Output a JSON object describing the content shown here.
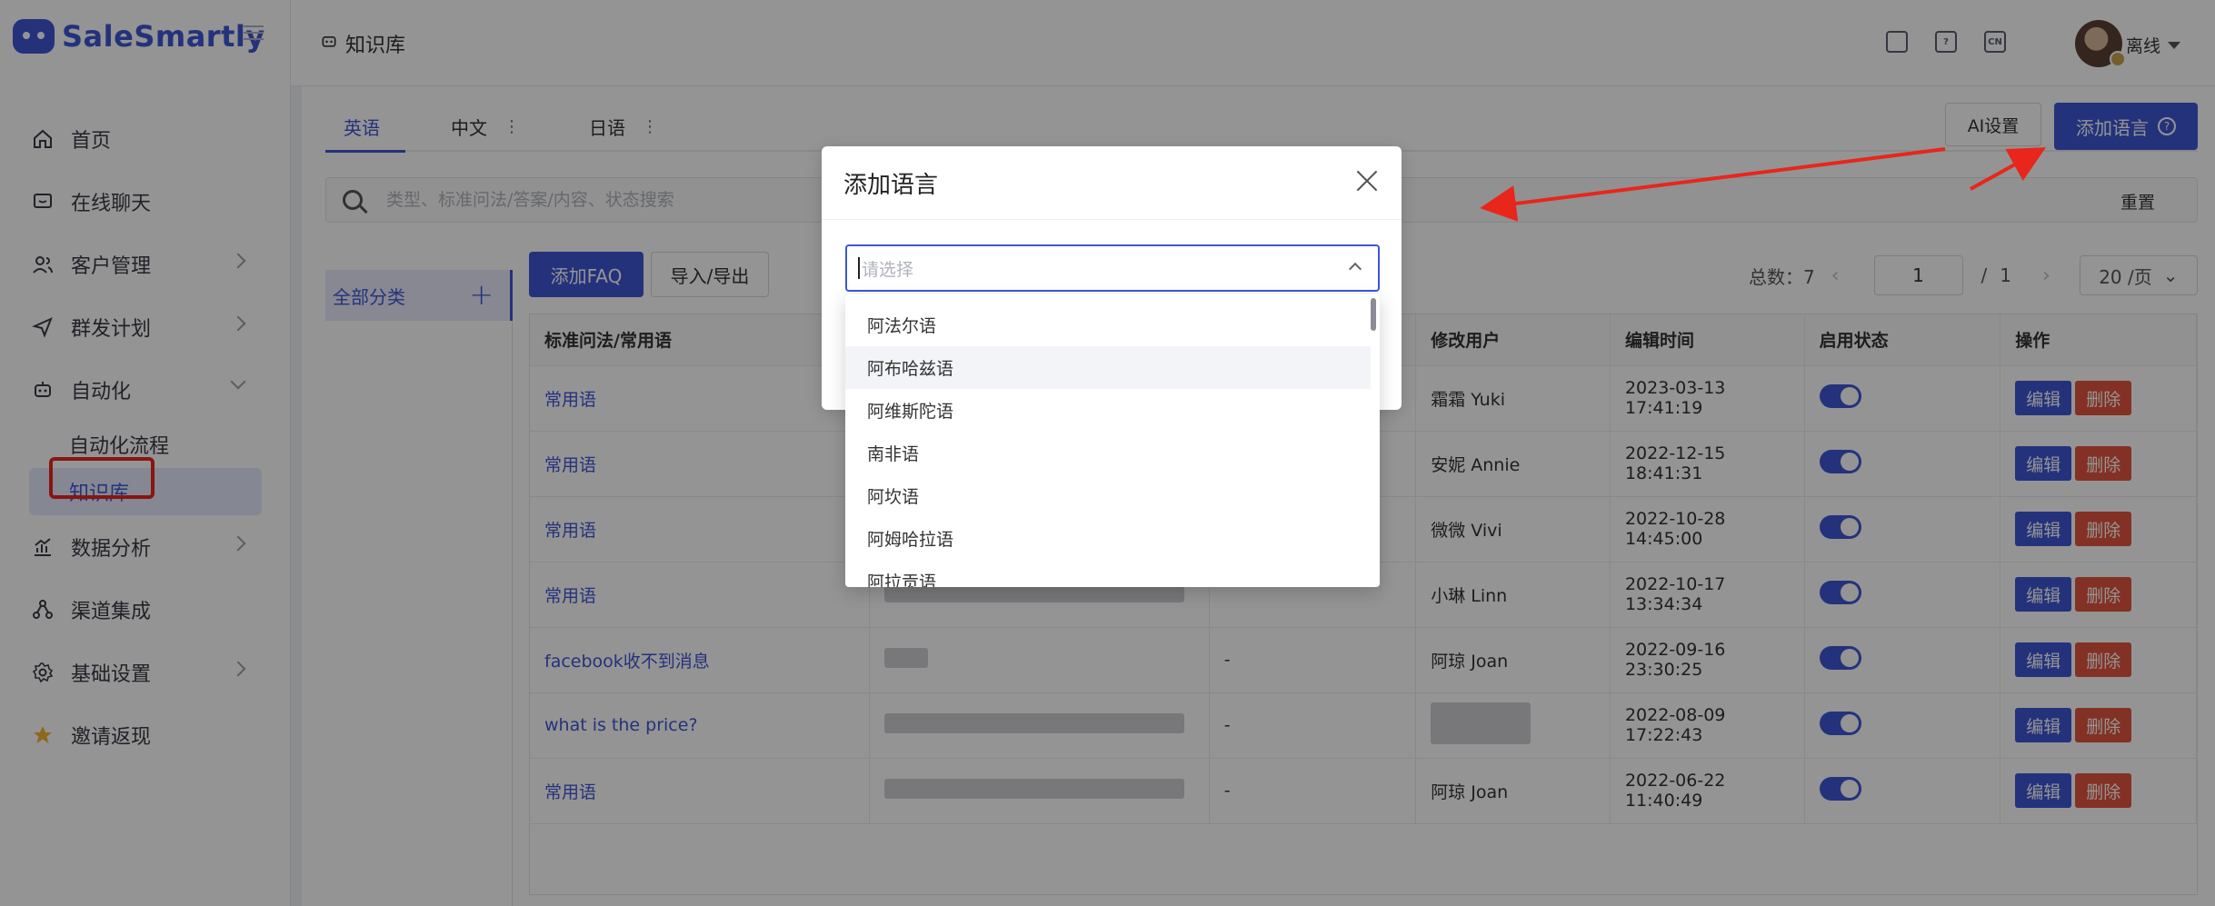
{
  "brand": {
    "name": "SaleSmartly"
  },
  "sidebar": {
    "items": [
      {
        "label": "首页",
        "icon": "home-icon",
        "chevron": false
      },
      {
        "label": "在线聊天",
        "icon": "chat-icon",
        "chevron": false
      },
      {
        "label": "客户管理",
        "icon": "users-icon",
        "chevron": true
      },
      {
        "label": "群发计划",
        "icon": "send-icon",
        "chevron": true
      },
      {
        "label": "自动化",
        "icon": "robot-icon",
        "chevron": "down"
      }
    ],
    "automation_sub": [
      {
        "label": "自动化流程"
      },
      {
        "label": "知识库"
      }
    ],
    "items_after": [
      {
        "label": "数据分析",
        "icon": "analytics-icon",
        "chevron": true
      },
      {
        "label": "渠道集成",
        "icon": "channels-icon",
        "chevron": false
      },
      {
        "label": "基础设置",
        "icon": "settings-icon",
        "chevron": true
      },
      {
        "label": "邀请返现",
        "icon": "star-icon",
        "chevron": false
      }
    ]
  },
  "header": {
    "breadcrumb": "知识库",
    "icons": [
      "mobile-icon",
      "help-icon",
      "language-cn-icon"
    ],
    "lang_badge": "CN",
    "status": "离线"
  },
  "main": {
    "tabs": [
      {
        "label": "英语",
        "active": true
      },
      {
        "label": "中文",
        "active": false
      },
      {
        "label": "日语",
        "active": false
      }
    ],
    "ai_settings_label": "AI设置",
    "add_language_label": "添加语言",
    "search_placeholder": "类型、标准问法/答案/内容、状态搜索",
    "reset_label": "重置",
    "category_all": "全部分类",
    "add_faq_label": "添加FAQ",
    "import_export_label": "导入/导出",
    "pagination": {
      "total_label": "总数：7",
      "page": "1",
      "page_sep": "/",
      "total_pages": "1",
      "page_size": "20 /页"
    },
    "table": {
      "columns": [
        "标准问法/常用语",
        "",
        "",
        "修改用户",
        "编辑时间",
        "启用状态",
        "操作"
      ],
      "rows": [
        {
          "q": "常用语",
          "c3": "",
          "user": "霜霜 Yuki",
          "time": "2023-03-13 17:41:19"
        },
        {
          "q": "常用语",
          "c3": "",
          "user": "安妮 Annie",
          "time": "2022-12-15 18:41:31"
        },
        {
          "q": "常用语",
          "c3": "",
          "user": "微微 Vivi",
          "time": "2022-10-28 14:45:00"
        },
        {
          "q": "常用语",
          "c3": "",
          "user": "小琳 Linn",
          "time": "2022-10-17 13:34:34"
        },
        {
          "q": "facebook收不到消息",
          "c3": "-",
          "user": "阿琼 Joan",
          "time": "2022-09-16 23:30:25"
        },
        {
          "q": "what is the price?",
          "c3": "-",
          "user": "",
          "time": "2022-08-09 17:22:43"
        },
        {
          "q": "常用语",
          "c3": "-",
          "user": "阿琼 Joan",
          "time": "2022-06-22 11:40:49"
        }
      ],
      "edit_label": "编辑",
      "delete_label": "删除"
    }
  },
  "modal": {
    "title": "添加语言",
    "select_placeholder": "请选择",
    "options": [
      "阿法尔语",
      "阿布哈兹语",
      "阿维斯陀语",
      "南非语",
      "阿坎语",
      "阿姆哈拉语",
      "阿拉贡语"
    ],
    "hovered_option": "阿布哈兹语"
  },
  "colors": {
    "accent": "#3e57d6",
    "danger": "#e2553f",
    "annotation": "#e8261c"
  }
}
